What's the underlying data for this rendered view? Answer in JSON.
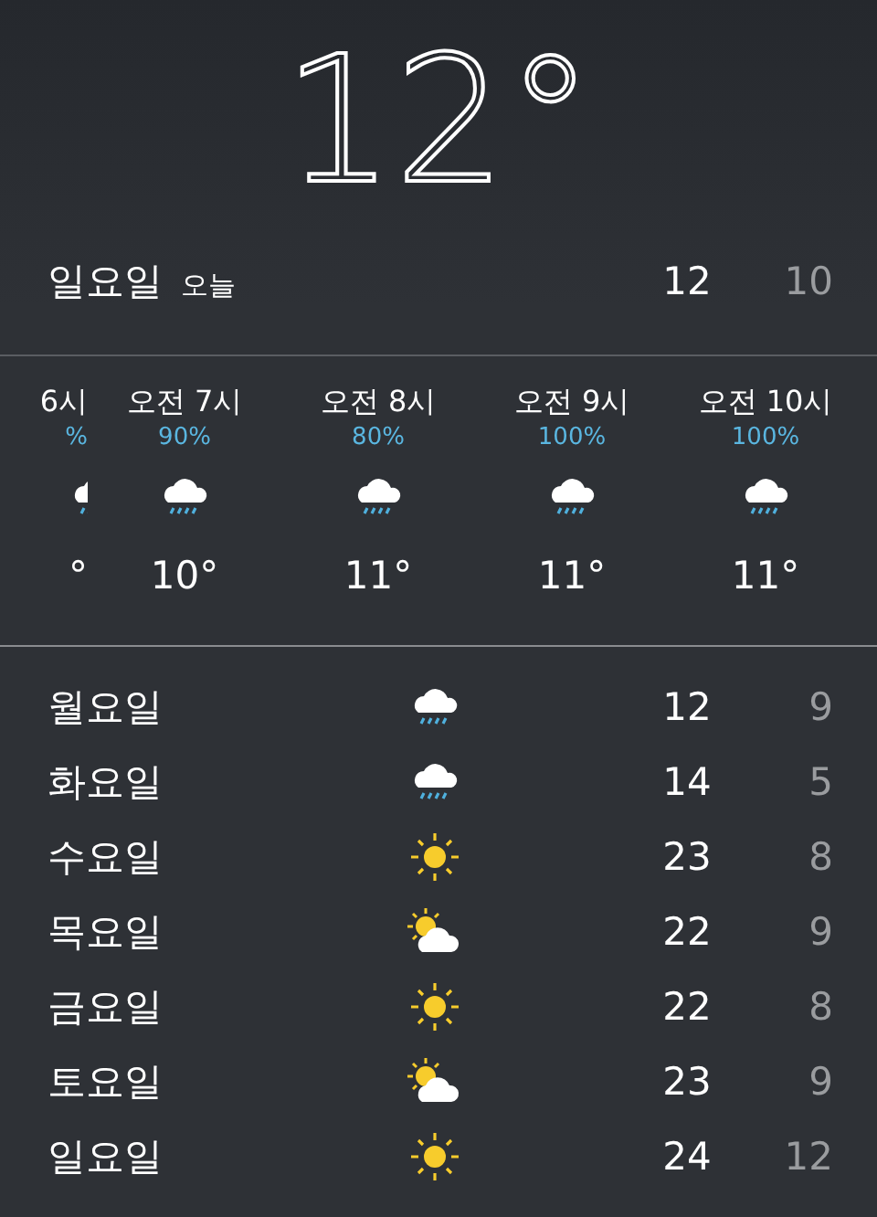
{
  "current": {
    "temperature": "12°"
  },
  "today": {
    "day": "일요일",
    "label": "오늘",
    "high": "12",
    "low": "10"
  },
  "hourly": [
    {
      "time": "6시",
      "chance": "%",
      "kind": "rain",
      "temp": "°"
    },
    {
      "time": "오전 7시",
      "chance": "90%",
      "kind": "rain",
      "temp": "10°"
    },
    {
      "time": "오전 8시",
      "chance": "80%",
      "kind": "rain",
      "temp": "11°"
    },
    {
      "time": "오전 9시",
      "chance": "100%",
      "kind": "rain",
      "temp": "11°"
    },
    {
      "time": "오전 10시",
      "chance": "100%",
      "kind": "rain",
      "temp": "11°"
    }
  ],
  "daily": [
    {
      "day": "월요일",
      "kind": "rain",
      "high": "12",
      "low": "9"
    },
    {
      "day": "화요일",
      "kind": "rain",
      "high": "14",
      "low": "5"
    },
    {
      "day": "수요일",
      "kind": "sun",
      "high": "23",
      "low": "8"
    },
    {
      "day": "목요일",
      "kind": "partly",
      "high": "22",
      "low": "9"
    },
    {
      "day": "금요일",
      "kind": "sun",
      "high": "22",
      "low": "8"
    },
    {
      "day": "토요일",
      "kind": "partly",
      "high": "23",
      "low": "9"
    },
    {
      "day": "일요일",
      "kind": "sun",
      "high": "24",
      "low": "12"
    }
  ]
}
